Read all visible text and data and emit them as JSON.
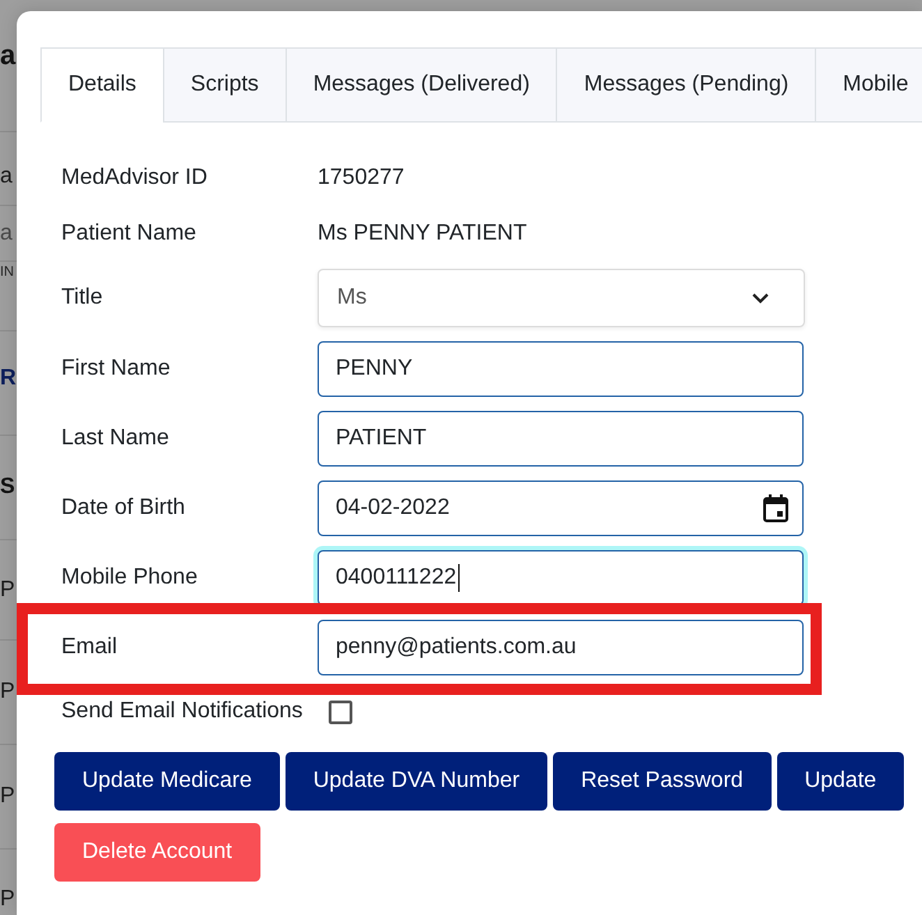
{
  "background_page": {
    "fragments": [
      {
        "text": "a",
        "kind": "heading"
      },
      {
        "text": "a",
        "kind": "text"
      },
      {
        "text": "a",
        "kind": "placeholder"
      },
      {
        "text": "IN",
        "kind": "caption"
      },
      {
        "text": "R",
        "kind": "link_heading"
      },
      {
        "text": "S",
        "kind": "bold"
      },
      {
        "text": "P",
        "kind": "text"
      },
      {
        "text": "P",
        "kind": "text"
      },
      {
        "text": "P",
        "kind": "text"
      },
      {
        "text": "P",
        "kind": "text"
      }
    ]
  },
  "dialog": {
    "tabs": [
      {
        "label": "Details",
        "selected": true
      },
      {
        "label": "Scripts",
        "selected": false
      },
      {
        "label": "Messages (Delivered)",
        "selected": false
      },
      {
        "label": "Messages (Pending)",
        "selected": false
      },
      {
        "label": "Mobile",
        "selected": false
      }
    ],
    "fields": [
      {
        "label": "MedAdvisor ID",
        "kind": "text",
        "value": "1750277",
        "focused": false,
        "highlighted": false
      },
      {
        "label": "Patient Name",
        "kind": "text",
        "value": "Ms PENNY PATIENT",
        "focused": false,
        "highlighted": false
      },
      {
        "label": "Title",
        "kind": "select",
        "value": "Ms",
        "focused": false,
        "highlighted": false
      },
      {
        "label": "First Name",
        "kind": "input",
        "value": "PENNY",
        "focused": false,
        "highlighted": false
      },
      {
        "label": "Last Name",
        "kind": "input",
        "value": "PATIENT",
        "focused": false,
        "highlighted": false
      },
      {
        "label": "Date of Birth",
        "kind": "date",
        "value": "04-02-2022",
        "focused": false,
        "highlighted": false
      },
      {
        "label": "Mobile Phone",
        "kind": "input",
        "value": "0400111222",
        "focused": true,
        "highlighted": false
      },
      {
        "label": "Email",
        "kind": "input",
        "value": "penny@patients.com.au",
        "focused": false,
        "highlighted": true
      },
      {
        "label": "Send Email Notifications",
        "kind": "checkbox",
        "checked": false,
        "focused": false,
        "highlighted": false
      }
    ],
    "buttons": [
      {
        "label": "Update Medicare",
        "kind": "primary"
      },
      {
        "label": "Update DVA Number",
        "kind": "primary"
      },
      {
        "label": "Reset Password",
        "kind": "primary"
      },
      {
        "label": "Update",
        "kind": "primary"
      },
      {
        "label": "Delete Account",
        "kind": "danger"
      }
    ]
  }
}
